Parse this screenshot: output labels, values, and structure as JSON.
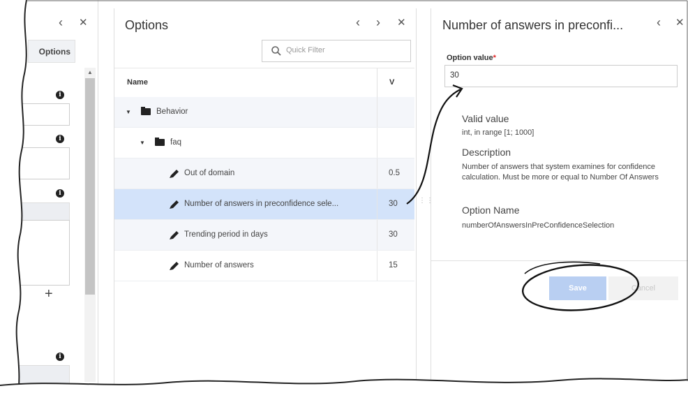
{
  "left_panel": {
    "tab_label": "Options",
    "add_glyph": "+"
  },
  "middle_panel": {
    "title": "Options",
    "quick_filter_placeholder": "Quick Filter",
    "columns": {
      "name": "Name",
      "value": "V"
    },
    "rows": [
      {
        "name": "Behavior",
        "value": "",
        "type": "folder",
        "level": 1
      },
      {
        "name": "faq",
        "value": "",
        "type": "folder",
        "level": 2
      },
      {
        "name": "Out of domain",
        "value": "0.5",
        "type": "option",
        "level": 3
      },
      {
        "name": "Number of answers in preconfidence sele...",
        "value": "30",
        "type": "option",
        "level": 3,
        "selected": true
      },
      {
        "name": "Trending period in days",
        "value": "30",
        "type": "option",
        "level": 3
      },
      {
        "name": "Number of answers",
        "value": "15",
        "type": "option",
        "level": 3
      }
    ]
  },
  "right_panel": {
    "title": "Number of answers in preconfi...",
    "option_value_label": "Option value",
    "required_mark": "*",
    "option_value": "30",
    "valid_value_heading": "Valid value",
    "valid_value_text": "int, in range [1; 1000]",
    "description_heading": "Description",
    "description_text": "Number of answers that system examines for confidence calculation. Must be more or equal to Number Of Answers",
    "option_name_heading": "Option Name",
    "option_name_text": "numberOfAnswersInPreConfidenceSelection",
    "save_label": "Save",
    "cancel_label": "Cancel"
  },
  "colors": {
    "selected_row": "#d3e3fa",
    "save_button": "#b9cff2",
    "required": "#e02424"
  }
}
